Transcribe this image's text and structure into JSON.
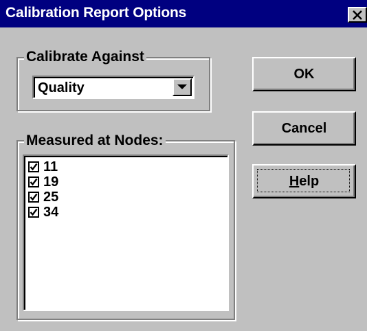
{
  "window": {
    "title": "Calibration Report Options",
    "close_icon": "close-x-icon"
  },
  "calibrate_group": {
    "label": "Calibrate Against",
    "selected_value": "Quality",
    "dropdown_icon": "chevron-down-icon"
  },
  "nodes_group": {
    "label": "Measured at Nodes:",
    "items": [
      {
        "label": "11",
        "checked": true
      },
      {
        "label": "19",
        "checked": true
      },
      {
        "label": "25",
        "checked": true
      },
      {
        "label": "34",
        "checked": true
      }
    ]
  },
  "buttons": {
    "ok": "OK",
    "cancel": "Cancel",
    "help_mnemonic": "H",
    "help_rest": "elp"
  },
  "colors": {
    "titlebar": "#000080",
    "face": "#c0c0c0"
  }
}
